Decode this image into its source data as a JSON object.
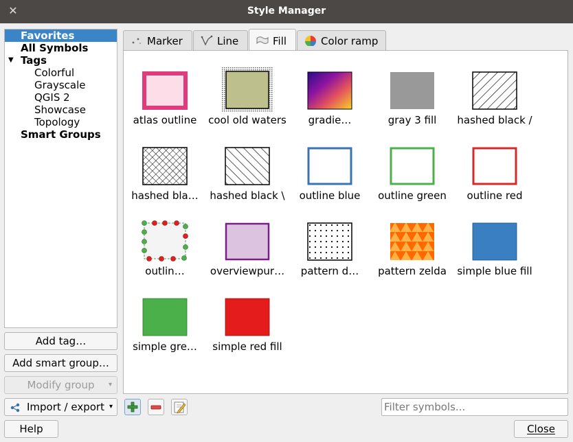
{
  "window": {
    "title": "Style Manager",
    "close_glyph": "✕"
  },
  "tree": {
    "items": [
      {
        "label": "Favorites"
      },
      {
        "label": "All Symbols"
      },
      {
        "label": "Tags"
      },
      {
        "label": "Colorful"
      },
      {
        "label": "Grayscale"
      },
      {
        "label": "QGIS 2"
      },
      {
        "label": "Showcase"
      },
      {
        "label": "Topology"
      },
      {
        "label": "Smart Groups"
      }
    ]
  },
  "left_buttons": {
    "add_tag": "Add tag…",
    "add_smart_group": "Add smart group…",
    "modify_group": "Modify group",
    "import_export": "Import / export",
    "help": "Help"
  },
  "tabs": [
    {
      "label": "Marker",
      "icon": "marker-icon"
    },
    {
      "label": "Line",
      "icon": "line-icon"
    },
    {
      "label": "Fill",
      "icon": "fill-icon"
    },
    {
      "label": "Color ramp",
      "icon": "color-ramp-icon"
    }
  ],
  "symbols": [
    {
      "label": "atlas outline"
    },
    {
      "label": "cool old waters"
    },
    {
      "label": "gradie…"
    },
    {
      "label": "gray 3 fill"
    },
    {
      "label": "hashed black /"
    },
    {
      "label": "hashed bla…"
    },
    {
      "label": "hashed black \\"
    },
    {
      "label": "outline blue"
    },
    {
      "label": "outline green"
    },
    {
      "label": "outline red"
    },
    {
      "label": "outlin…"
    },
    {
      "label": "overviewpur…"
    },
    {
      "label": "pattern d…"
    },
    {
      "label": "pattern zelda"
    },
    {
      "label": "simple blue fill"
    },
    {
      "label": "simple gre…"
    },
    {
      "label": "simple red fill"
    }
  ],
  "filter": {
    "placeholder": "Filter symbols..."
  },
  "bottom": {
    "close": "Close"
  },
  "colors": {
    "selection": "#3a85c8",
    "atlas_pink": "#e03b7c",
    "outline_blue": "#3a74b0",
    "outline_green": "#4bb04a",
    "outline_red": "#d42a2a",
    "simple_blue": "#3a7fc1",
    "simple_green": "#4bb04a",
    "simple_red": "#e51c1c"
  }
}
